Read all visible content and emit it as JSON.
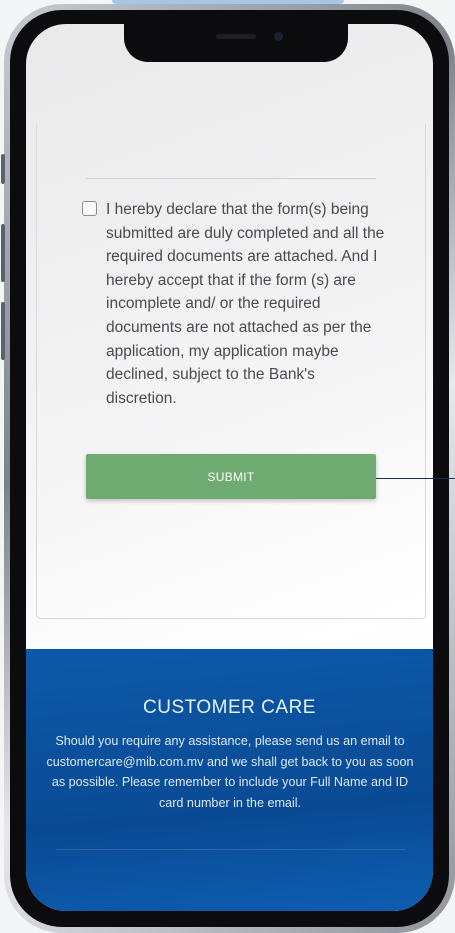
{
  "declaration": {
    "text": "I hereby declare that the form(s) being submitted are duly completed and all the required documents are attached. And I hereby accept that if the form (s) are incomplete and/ or the required documents are not attached as per the application, my application maybe declined, subject to the Bank's discretion.",
    "checked": false
  },
  "form": {
    "submit_label": "SUBMIT"
  },
  "customer_care": {
    "title": "CUSTOMER CARE",
    "text": "Should you require any assistance, please send us an email to customercare@mib.com.mv and we shall get back to you as soon as possible. Please remember to include your Full Name and ID card number in the email."
  },
  "colors": {
    "submit_button": "#6eab71",
    "care_background": "#0a4a94"
  }
}
